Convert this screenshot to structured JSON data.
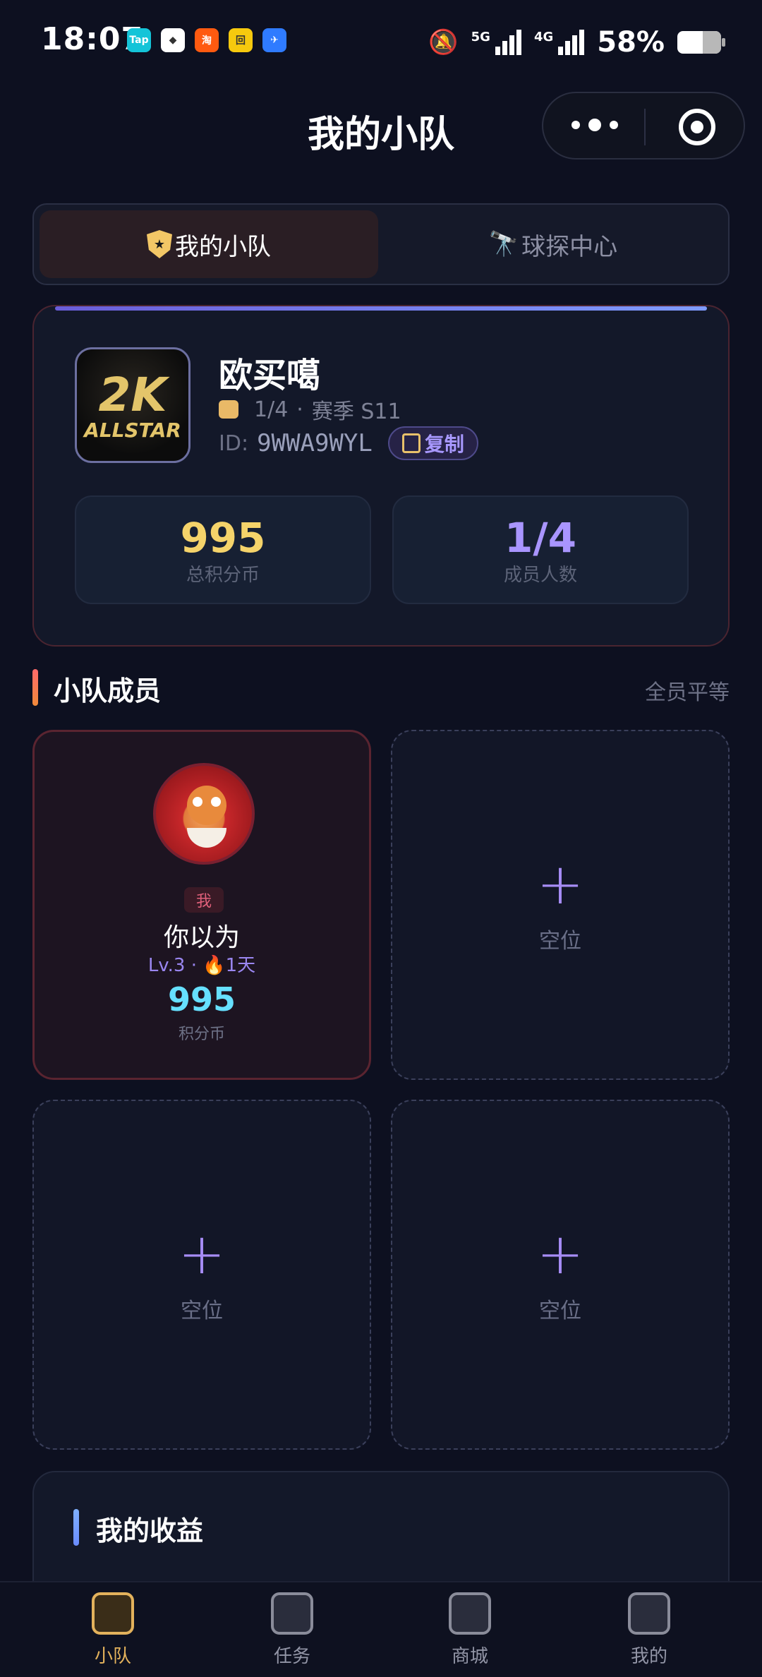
{
  "status_bar": {
    "time": "18:07",
    "apps": [
      {
        "icon": "taptap-icon",
        "text": "Tap",
        "color": "#14c4d8"
      },
      {
        "icon": "app-icon",
        "text": "◆",
        "color": "#ffffff"
      },
      {
        "icon": "taobao-icon",
        "text": "淘",
        "color": "#ff5a10"
      },
      {
        "icon": "app-icon",
        "text": "回",
        "color": "#f6c90e"
      },
      {
        "icon": "app-icon",
        "text": "✈",
        "color": "#2f7bff"
      }
    ],
    "network_1": "5G",
    "network_2": "4G",
    "battery_percent": "58%",
    "battery_level": 0.58
  },
  "header": {
    "title": "我的小队"
  },
  "tabs": {
    "active_label": "我的小队",
    "inactive_label": "球探中心"
  },
  "team": {
    "logo_line1": "2K",
    "logo_line2": "ALLSTAR",
    "name": "欧买噶",
    "members_short": "1/4",
    "separator": "·",
    "season": "赛季 S11",
    "id_label": "ID:",
    "id_value": "9WWA9WYL",
    "copy_label": "复制",
    "stats": [
      {
        "value": "995",
        "label": "总积分币",
        "color": "#f5d36a"
      },
      {
        "value": "1/4",
        "label": "成员人数",
        "color": "#a995ff"
      }
    ]
  },
  "members_section": {
    "title": "小队成员",
    "right_text": "全员平等",
    "me": {
      "badge": "我",
      "name": "你以为",
      "level": "Lv.3 · 🔥1天",
      "score": "995",
      "score_label": "积分币"
    },
    "empty_slot": {
      "plus": "+",
      "label": "空位"
    }
  },
  "earnings": {
    "title": "我的收益"
  },
  "tabbar": [
    {
      "label": "小队",
      "icon": "team-icon",
      "active": true
    },
    {
      "label": "任务",
      "icon": "task-icon",
      "active": false
    },
    {
      "label": "商城",
      "icon": "shop-icon",
      "active": false
    },
    {
      "label": "我的",
      "icon": "profile-icon",
      "active": false
    }
  ]
}
